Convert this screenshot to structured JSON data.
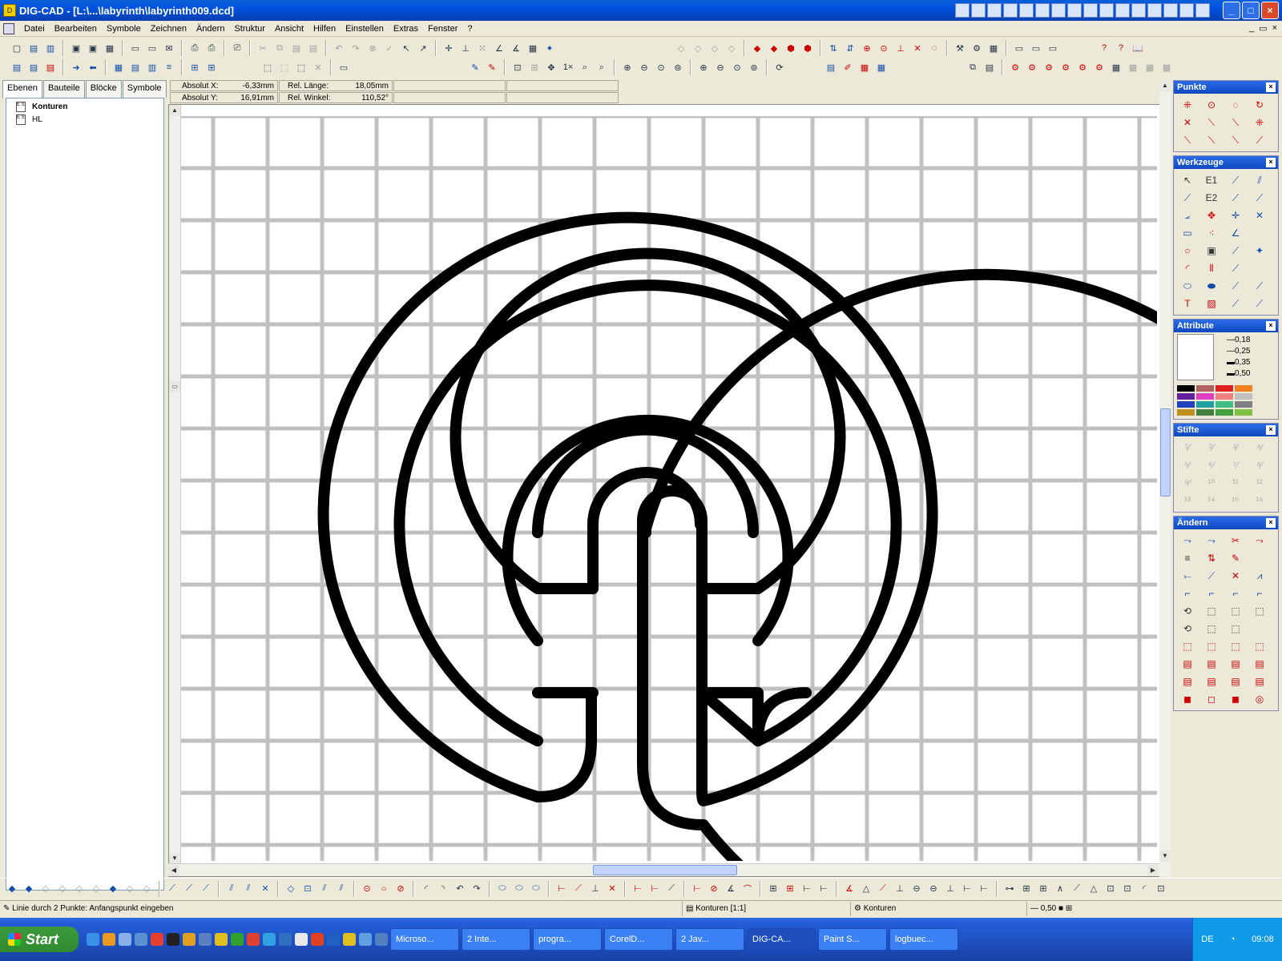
{
  "window": {
    "title": "DIG-CAD - [L:\\...\\labyrinth\\labyrinth009.dcd]"
  },
  "menu": [
    "Datei",
    "Bearbeiten",
    "Symbole",
    "Zeichnen",
    "Ändern",
    "Struktur",
    "Ansicht",
    "Hilfen",
    "Einstellen",
    "Extras",
    "Fenster",
    "?"
  ],
  "left_panel": {
    "tabs": [
      "Ebenen",
      "Bauteile",
      "Blöcke",
      "Symbole"
    ],
    "layers": [
      "Konturen",
      "HL"
    ]
  },
  "coords": {
    "abs_x_label": "Absolut X:",
    "abs_x": "-6,33mm",
    "abs_y_label": "Absolut Y:",
    "abs_y": "16,91mm",
    "rel_len_label": "Rel. Länge:",
    "rel_len": "18,05mm",
    "rel_ang_label": "Rel. Winkel:",
    "rel_ang": "110,52°"
  },
  "palettes": {
    "punkte": "Punkte",
    "werkzeuge": "Werkzeuge",
    "attribute": "Attribute",
    "stifte": "Stifte",
    "aendern": "Ändern",
    "line_widths": [
      "0,18",
      "0,25",
      "0,35",
      "0,50"
    ],
    "colors": [
      "#000000",
      "#b06060",
      "#e02020",
      "#f08020",
      "#6020a0",
      "#e040c0",
      "#f08080",
      "#c0c0c0",
      "#2040c0",
      "#20a0a0",
      "#40c080",
      "#808080",
      "#c09020",
      "#408040",
      "#40a040",
      "#80c040"
    ]
  },
  "statusbar": {
    "prompt": "Linie durch 2 Punkte: Anfangspunkt eingeben",
    "layer": "Konturen [1:1]",
    "layer2": "Konturen",
    "pen": "0,50"
  },
  "taskbar": {
    "start": "Start",
    "tasks": [
      "Microso...",
      "2 Inte...",
      "progra...",
      "CorelD...",
      "2 Jav...",
      "DIG-CA...",
      "Paint S...",
      "logbuec..."
    ],
    "lang": "DE",
    "time": "09:08"
  },
  "colors": {
    "accent": "#0a5fd8",
    "grid": "#c0c0c0",
    "line": "#000000"
  }
}
